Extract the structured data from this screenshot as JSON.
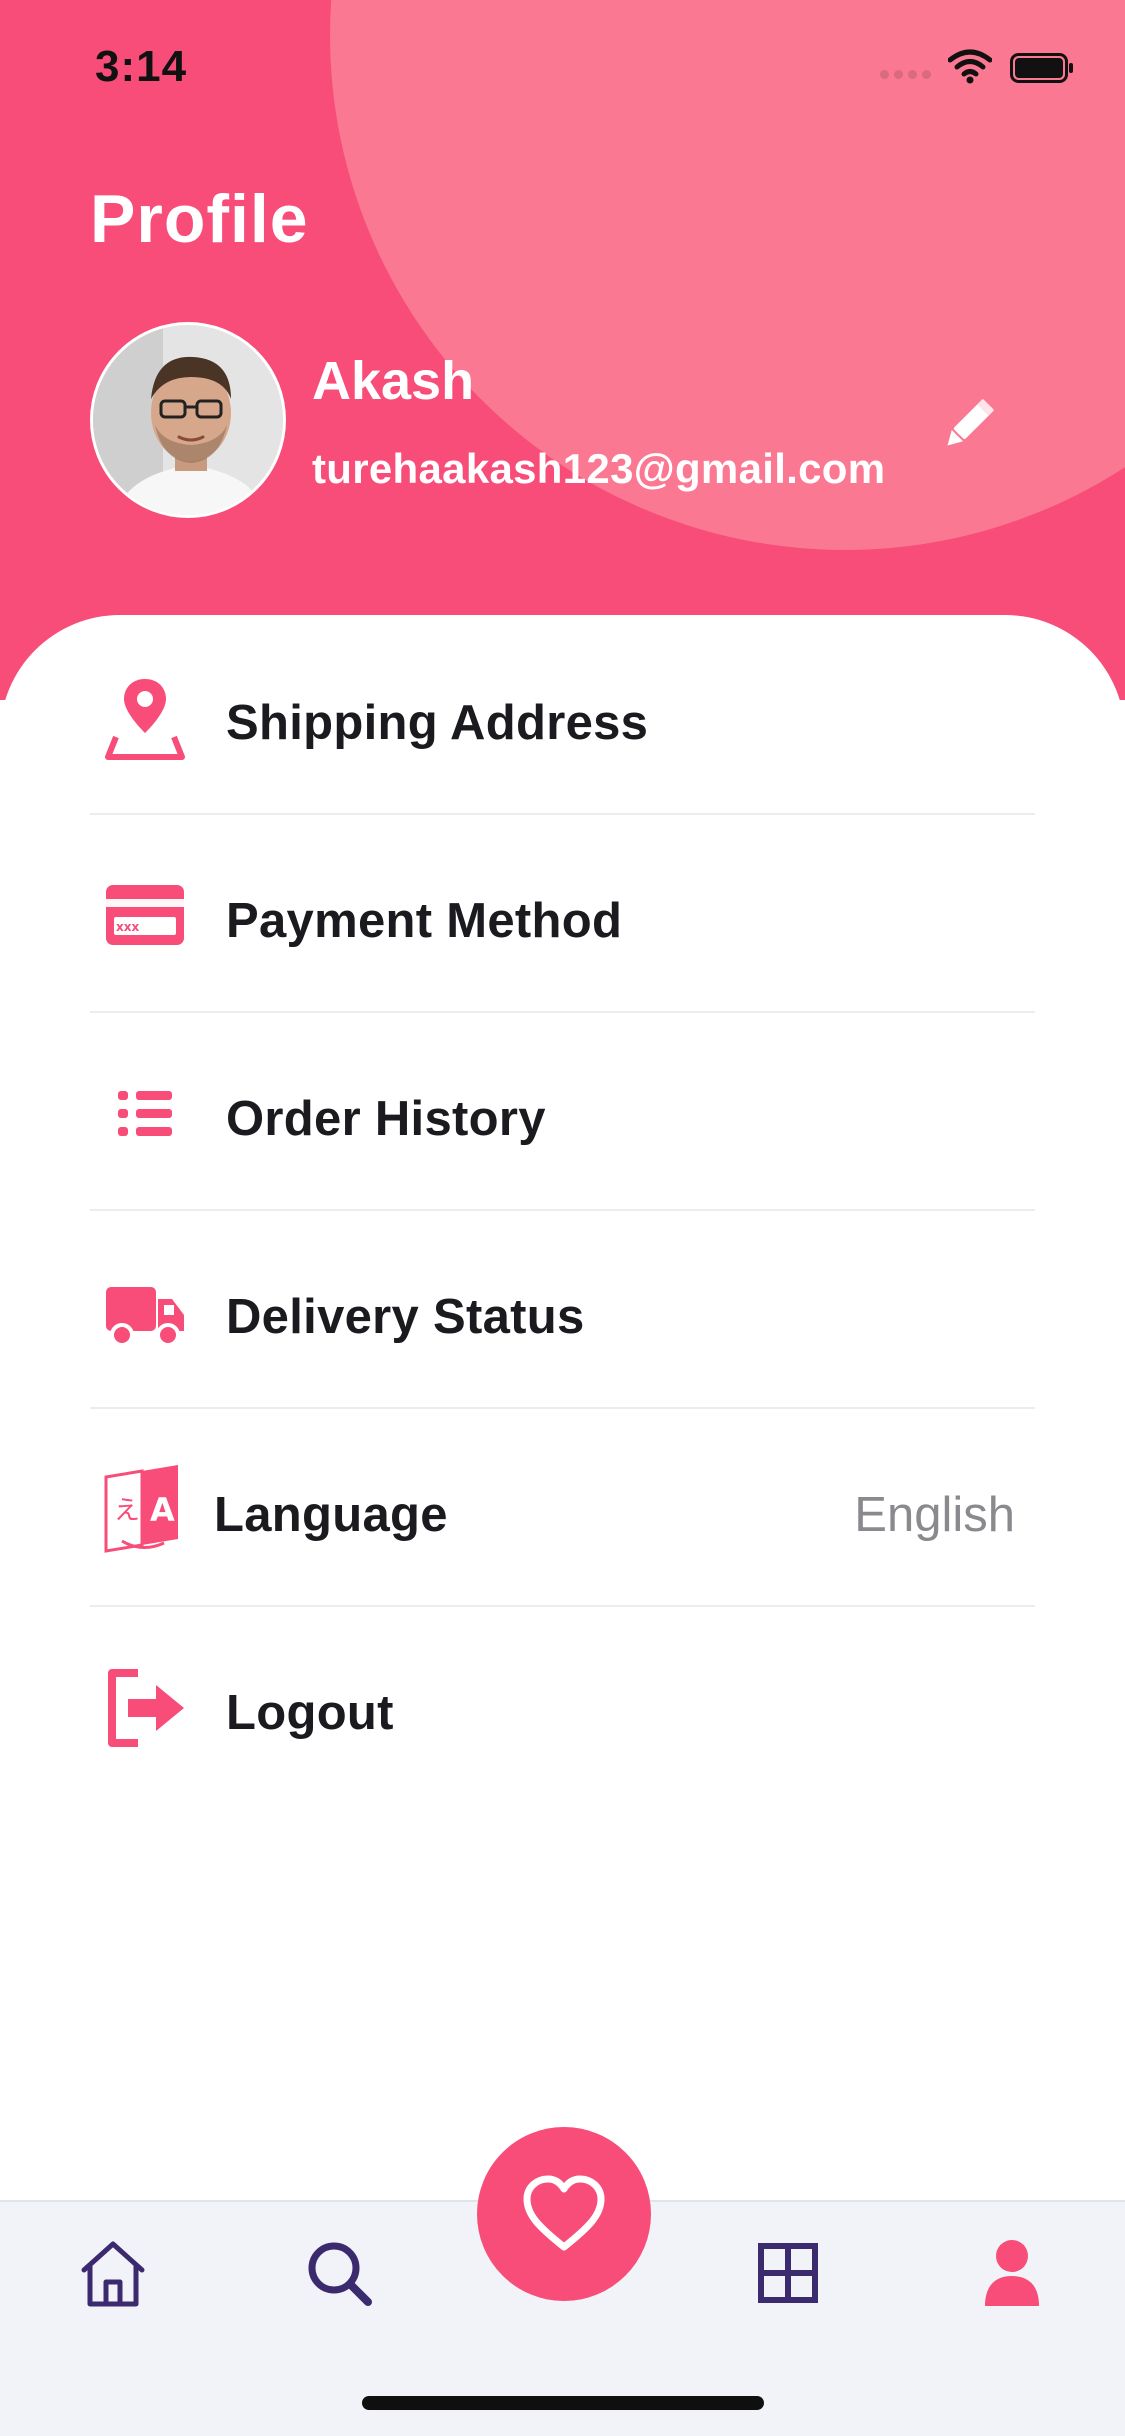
{
  "status_bar": {
    "time": "3:14"
  },
  "header": {
    "title": "Profile",
    "user": {
      "name": "Akash",
      "email": "turehaakash123@gmail.com"
    }
  },
  "menu": {
    "items": [
      {
        "label": "Shipping Address",
        "icon": "location-pin-icon"
      },
      {
        "label": "Payment Method",
        "icon": "credit-card-icon"
      },
      {
        "label": "Order History",
        "icon": "list-icon"
      },
      {
        "label": "Delivery Status",
        "icon": "truck-icon"
      },
      {
        "label": "Language",
        "icon": "translate-icon",
        "value": "English"
      },
      {
        "label": "Logout",
        "icon": "logout-icon"
      }
    ]
  },
  "bottom_nav": {
    "items": [
      "home-icon",
      "search-icon",
      "heart-icon",
      "grid-icon",
      "user-icon"
    ],
    "active": "user-icon"
  },
  "colors": {
    "accent": "#f74d78",
    "accent_light": "#fa7891",
    "nav_icon": "#3b2a6e",
    "text": "#1b1b1f",
    "muted": "#8a8a8e"
  }
}
